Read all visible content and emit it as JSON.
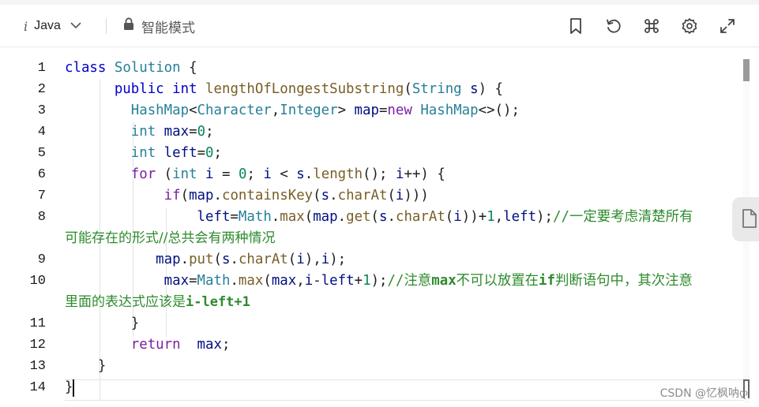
{
  "toolbar": {
    "language": "Java",
    "mode_label": "智能模式",
    "icons": [
      "bookmark-icon",
      "reset-icon",
      "shortcut-command-icon",
      "settings-gear-icon",
      "fullscreen-expand-icon"
    ]
  },
  "editor": {
    "line_numbers": [
      "1",
      "2",
      "3",
      "4",
      "5",
      "6",
      "7",
      "8",
      "9",
      "10",
      "11",
      "12",
      "13",
      "14"
    ],
    "wrapped_line_8": "可能存在的形式//总共会有两种情况",
    "wrapped_line_10_text": "里面的表达式应该是",
    "wrapped_line_10_bold": "i-left+1",
    "comment_line_8": "//一定要考虑清楚所有",
    "comment_line_10_a": "//注意",
    "comment_line_10_b": "max",
    "comment_line_10_c": "不可以放置在",
    "comment_line_10_d": "if",
    "comment_line_10_e": "判断语句中，其次注意"
  },
  "watermark": "CSDN @忆枫呐ღ",
  "colors": {
    "keyword": "#7a1fa2",
    "type": "#267f99",
    "function": "#795e26",
    "number": "#098658",
    "comment": "#2e8b2e"
  }
}
